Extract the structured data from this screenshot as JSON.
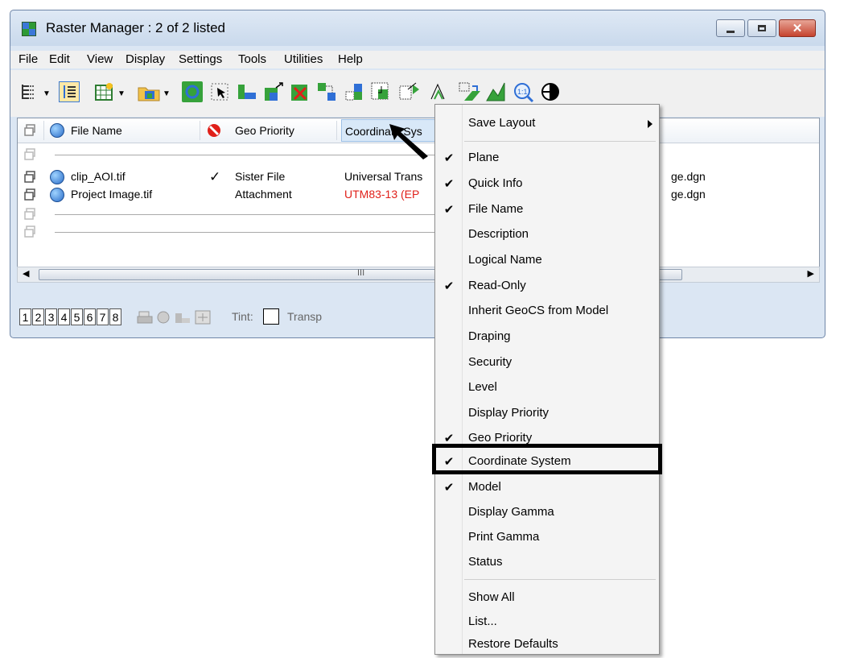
{
  "window": {
    "title": "Raster Manager : 2 of 2 listed",
    "close_glyph": "✕"
  },
  "menubar": [
    "File",
    "Edit",
    "View",
    "Display",
    "Settings",
    "Tools",
    "Utilities",
    "Help"
  ],
  "columns": {
    "file_name": "File Name",
    "geo_priority": "Geo Priority",
    "coordinate_system": "Coordinate Sys"
  },
  "rows": [
    {
      "file_name": "clip_AOI.tif",
      "check": "✓",
      "geo_priority": "Sister File",
      "coordinate_system": "Universal Trans",
      "model": "ge.dgn"
    },
    {
      "file_name": "Project Image.tif",
      "check": "",
      "geo_priority": "Attachment",
      "coordinate_system": "UTM83-13 (EP",
      "model": "ge.dgn"
    }
  ],
  "bottom": {
    "views": [
      "1",
      "2",
      "3",
      "4",
      "5",
      "6",
      "7",
      "8"
    ],
    "tint_label": "Tint:",
    "transparency_label": "Transp"
  },
  "scroll_glyph": "III",
  "context_menu": {
    "items": [
      {
        "label": "Save Layout",
        "checked": false,
        "submenu": true
      },
      {
        "label": "Plane",
        "checked": true
      },
      {
        "label": "Quick Info",
        "checked": true
      },
      {
        "label": "File Name",
        "checked": true
      },
      {
        "label": "Description",
        "checked": false
      },
      {
        "label": "Logical Name",
        "checked": false
      },
      {
        "label": "Read-Only",
        "checked": true
      },
      {
        "label": "Inherit GeoCS from Model",
        "checked": false
      },
      {
        "label": "Draping",
        "checked": false
      },
      {
        "label": "Security",
        "checked": false
      },
      {
        "label": "Level",
        "checked": false
      },
      {
        "label": "Display Priority",
        "checked": false
      },
      {
        "label": "Geo Priority",
        "checked": true
      },
      {
        "label": "Coordinate System",
        "checked": true
      },
      {
        "label": "Model",
        "checked": true
      },
      {
        "label": "Display Gamma",
        "checked": false
      },
      {
        "label": "Print Gamma",
        "checked": false
      },
      {
        "label": "Status",
        "checked": false
      },
      {
        "label": "Show All",
        "checked": false
      },
      {
        "label": "List...",
        "checked": false
      },
      {
        "label": "Restore Defaults",
        "checked": false
      }
    ],
    "check_glyph": "✔"
  },
  "colors": {
    "error_text": "#e0201a",
    "highlight_border": "#000000"
  }
}
